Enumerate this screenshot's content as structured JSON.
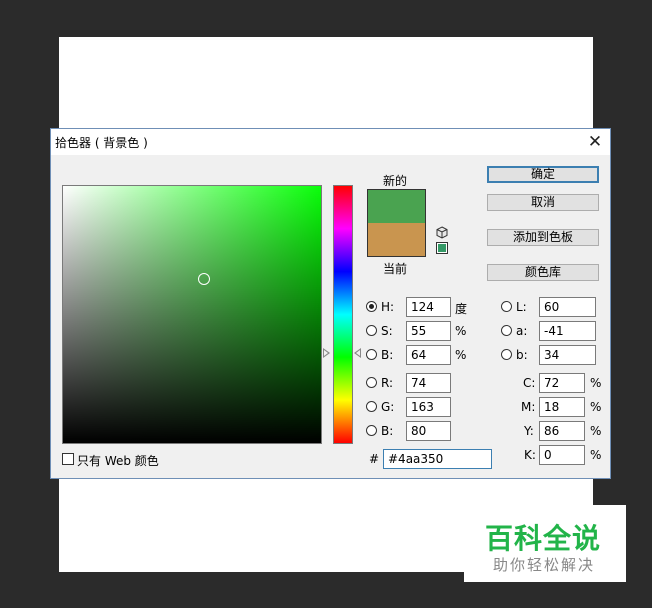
{
  "dialog": {
    "title": "拾色器 ( 背景色 )",
    "close_glyph": "✕"
  },
  "colors": {
    "field_hue": "#0aff0a",
    "new_color": "#4aa350",
    "current_color": "#c9954f",
    "websafe_color": "#339966"
  },
  "swatch": {
    "new_label": "新的",
    "current_label": "当前"
  },
  "buttons": {
    "ok": "确定",
    "cancel": "取消",
    "add_to_swatches": "添加到色板",
    "color_libraries": "颜色库"
  },
  "hsb": {
    "h_label": "H:",
    "h_value": "124",
    "h_unit": "度",
    "s_label": "S:",
    "s_value": "55",
    "s_unit": "%",
    "b_label": "B:",
    "b_value": "64",
    "b_unit": "%"
  },
  "rgb": {
    "r_label": "R:",
    "r_value": "74",
    "g_label": "G:",
    "g_value": "163",
    "b_label": "B:",
    "b_value": "80"
  },
  "lab": {
    "l_label": "L:",
    "l_value": "60",
    "a_label": "a:",
    "a_value": "-41",
    "b_label": "b:",
    "b_value": "34"
  },
  "cmyk": {
    "c_label": "C:",
    "c_value": "72",
    "m_label": "M:",
    "m_value": "18",
    "y_label": "Y:",
    "y_value": "86",
    "k_label": "K:",
    "k_value": "0",
    "unit": "%"
  },
  "hex": {
    "label": "#",
    "value": "#4aa350"
  },
  "web_only_label": "只有 Web 颜色",
  "watermark": {
    "title": "百科全说",
    "subtitle": "助你轻松解决"
  }
}
